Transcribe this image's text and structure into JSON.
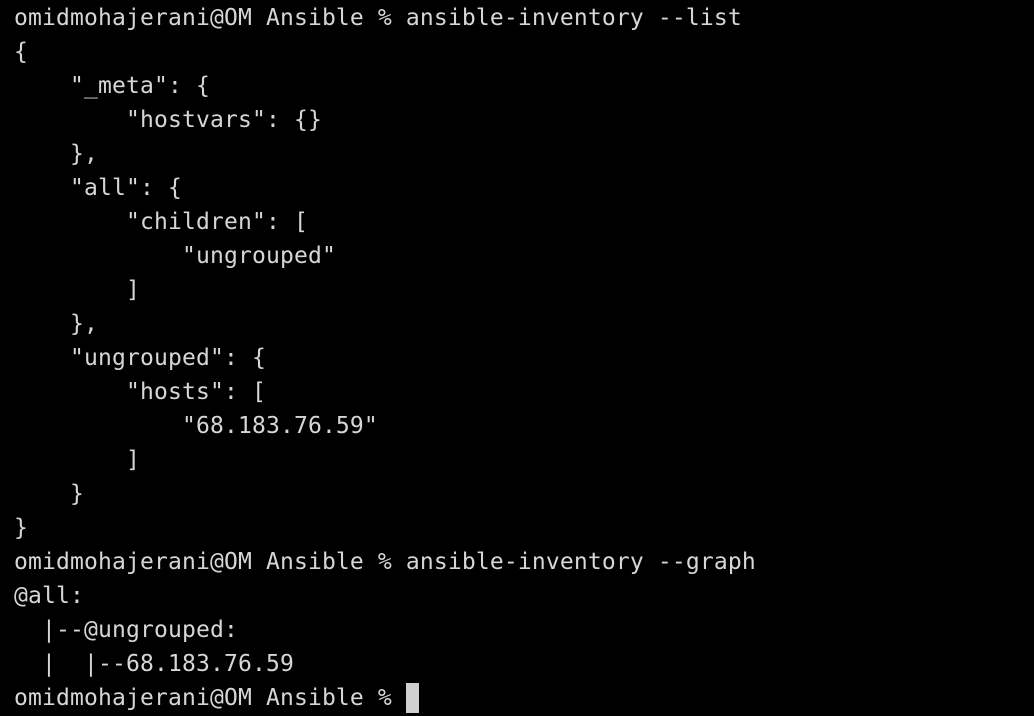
{
  "terminal": {
    "prompt": "omidmohajerani@OM Ansible % ",
    "lines": [
      "omidmohajerani@OM Ansible % ansible-inventory --list",
      "{",
      "    \"_meta\": {",
      "        \"hostvars\": {}",
      "    },",
      "    \"all\": {",
      "        \"children\": [",
      "            \"ungrouped\"",
      "        ]",
      "    },",
      "    \"ungrouped\": {",
      "        \"hosts\": [",
      "            \"68.183.76.59\"",
      "        ]",
      "    }",
      "}",
      "omidmohajerani@OM Ansible % ansible-inventory --graph",
      "@all:",
      "  |--@ungrouped:",
      "  |  |--68.183.76.59"
    ],
    "colors": {
      "background": "#000000",
      "text": "#d6d6d6",
      "cursor": "#d0d0d0"
    }
  }
}
